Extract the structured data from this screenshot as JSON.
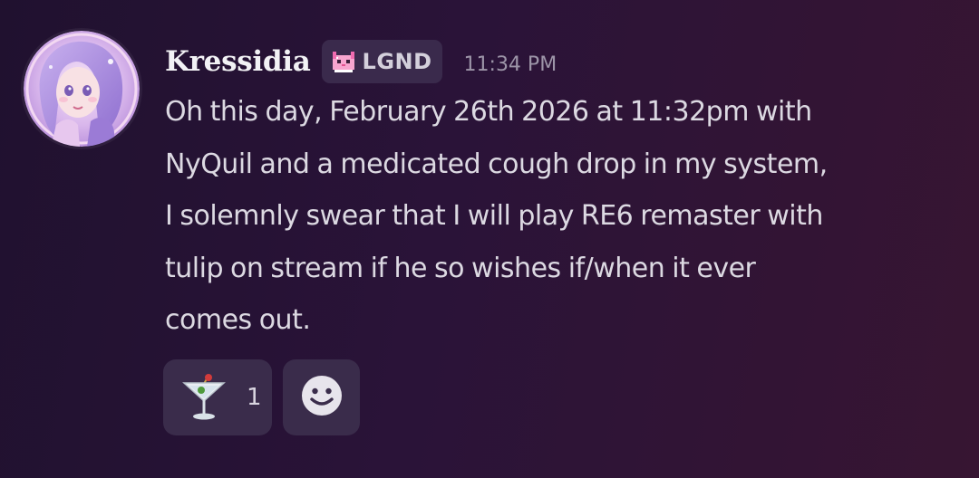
{
  "message": {
    "author": "Kressidia",
    "tag": {
      "label": "LGND",
      "icon": "pixel-cat-icon"
    },
    "timestamp": "11:34 PM",
    "lines": [
      "Oh this day, February 26th 2026 at 11:32pm with",
      "NyQuil and a medicated cough drop in my system,",
      "I solemnly swear that I will play RE6 remaster with",
      "tulip on stream if he so wishes if/when it ever",
      "comes out."
    ]
  },
  "reactions": [
    {
      "icon": "cocktail-glass-icon",
      "count": "1"
    }
  ],
  "add_reaction": {
    "icon": "smiley-face-icon"
  },
  "colors": {
    "background_start": "#20112f",
    "background_end": "#371532",
    "pill": "#3a2c4b",
    "username": "#f2f2f5",
    "body_text": "#dcd9e2",
    "timestamp": "#9d95a8"
  }
}
